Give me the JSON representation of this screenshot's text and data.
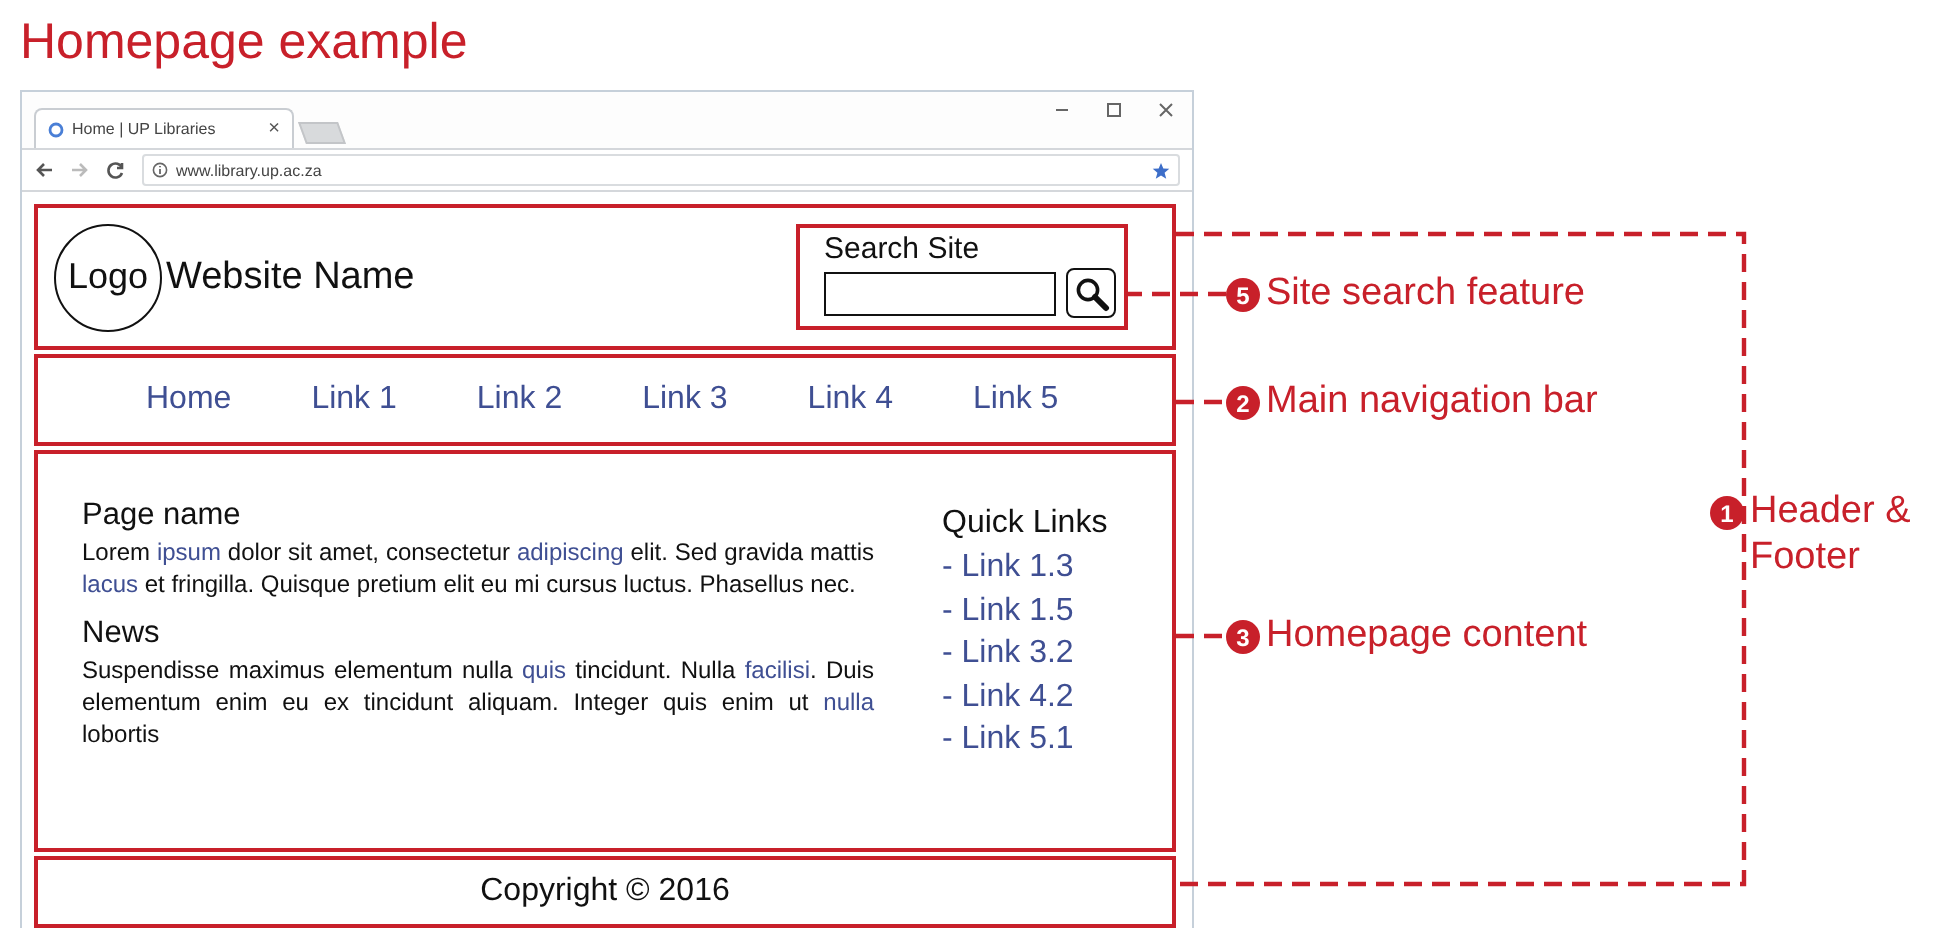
{
  "title": "Homepage example",
  "browser": {
    "tabs": [
      {
        "title": "Home | UP Libraries",
        "close": "×",
        "selected": true
      }
    ],
    "url": "www.library.up.ac.za"
  },
  "site": {
    "logo": "Logo",
    "name": "Website Name",
    "search": {
      "label": "Search Site"
    },
    "nav": [
      {
        "label": "Home"
      },
      {
        "label": "Link 1"
      },
      {
        "label": "Link 2"
      },
      {
        "label": "Link 3"
      },
      {
        "label": "Link 4"
      },
      {
        "label": "Link 5"
      }
    ],
    "sections": [
      {
        "heading": "Page name",
        "body": [
          {
            "text": "Lorem ",
            "link": false
          },
          {
            "text": "ipsum",
            "link": true
          },
          {
            "text": " dolor sit amet, consectetur ",
            "link": false
          },
          {
            "text": "adipiscing",
            "link": true
          },
          {
            "text": " elit. Sed gravida mattis ",
            "link": false
          },
          {
            "text": "lacus",
            "link": true
          },
          {
            "text": " et fringilla. Quisque pretium elit eu mi cursus luctus. Phasellus nec.",
            "link": false
          }
        ]
      },
      {
        "heading": "News",
        "body": [
          {
            "text": "Suspendisse maximus elementum nulla ",
            "link": false
          },
          {
            "text": "quis",
            "link": true
          },
          {
            "text": " tincidunt. Nulla ",
            "link": false
          },
          {
            "text": "facilisi",
            "link": true
          },
          {
            "text": ". Duis elementum enim eu ex tincidunt aliquam. Integer quis enim ut ",
            "link": false
          },
          {
            "text": "nulla",
            "link": true
          },
          {
            "text": " lobortis",
            "link": false
          }
        ]
      }
    ],
    "quick_links": {
      "heading": "Quick Links",
      "items": [
        "- Link 1.3",
        "- Link 1.5",
        "- Link 3.2",
        "- Link 4.2",
        "- Link 5.1"
      ]
    },
    "footer": "Copyright © 2016"
  },
  "annotations": [
    {
      "kind": "search",
      "number": "5",
      "label": "Site search feature"
    },
    {
      "kind": "nav",
      "number": "2",
      "label": "Main navigation bar"
    },
    {
      "kind": "header_footer",
      "number": "1",
      "label": "Header & Footer"
    },
    {
      "kind": "content",
      "number": "3",
      "label": "Homepage content"
    }
  ]
}
